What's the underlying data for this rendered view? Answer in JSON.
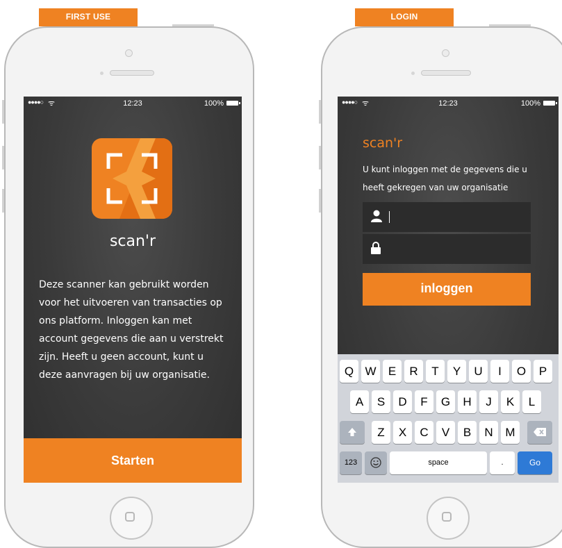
{
  "first_use": {
    "tag_label": "FIRST USE",
    "status": {
      "time": "12:23",
      "battery": "100%"
    },
    "app_name": "scan'r",
    "description": "Deze scanner kan gebruikt worden voor het uitvoeren van transacties op ons platform. Inloggen kan met account gegevens die aan u verstrekt zijn. Heeft u geen account, kunt u deze aanvragen bij uw organisatie.",
    "start_button": "Starten"
  },
  "login": {
    "tag_label": "LOGIN",
    "status": {
      "time": "12:23",
      "battery": "100%"
    },
    "app_name": "scan'r",
    "intro": "U kunt inloggen met de gegevens die u heeft gekregen van uw organisatie",
    "username_value": "",
    "password_value": "",
    "login_button": "inloggen",
    "keyboard": {
      "row1": [
        "Q",
        "W",
        "E",
        "R",
        "T",
        "Y",
        "U",
        "I",
        "O",
        "P"
      ],
      "row2": [
        "A",
        "S",
        "D",
        "F",
        "G",
        "H",
        "J",
        "K",
        "L"
      ],
      "row3": [
        "Z",
        "X",
        "C",
        "V",
        "B",
        "N",
        "M"
      ],
      "numbers_key": "123",
      "space_key": "space",
      "period_key": ".",
      "go_key": "Go"
    }
  },
  "colors": {
    "accent": "#ef8222",
    "screen_bg": "#3a3a3a",
    "field_bg": "#2c2c2c",
    "go_key": "#2e7ad6"
  }
}
